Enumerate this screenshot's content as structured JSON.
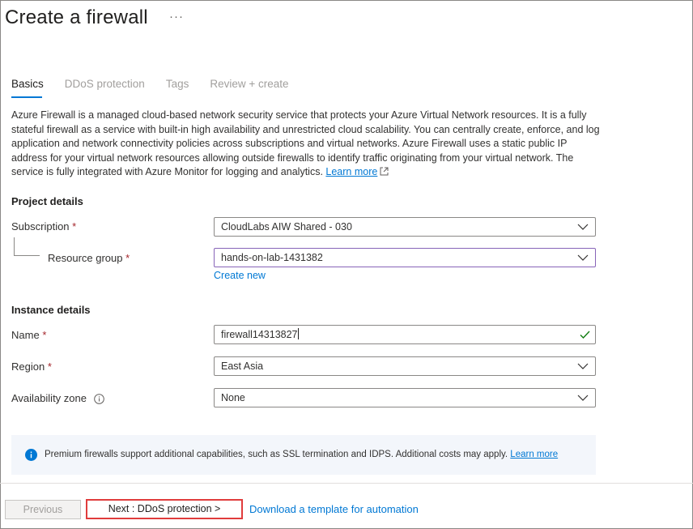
{
  "page": {
    "title": "Create a firewall",
    "more": "···"
  },
  "tabs": [
    {
      "label": "Basics",
      "active": true
    },
    {
      "label": "DDoS protection",
      "active": false
    },
    {
      "label": "Tags",
      "active": false
    },
    {
      "label": "Review + create",
      "active": false
    }
  ],
  "description": {
    "text": "Azure Firewall is a managed cloud-based network security service that protects your Azure Virtual Network resources. It is a fully stateful firewall as a service with built-in high availability and unrestricted cloud scalability. You can centrally create, enforce, and log application and network connectivity policies across subscriptions and virtual networks. Azure Firewall uses a static public IP address for your virtual network resources allowing outside firewalls to identify traffic originating from your virtual network. The service is fully integrated with Azure Monitor for logging and analytics.",
    "learn_more": "Learn more"
  },
  "project_details": {
    "heading": "Project details",
    "subscription_label": "Subscription",
    "subscription_value": "CloudLabs AIW Shared - 030",
    "resource_group_label": "Resource group",
    "resource_group_value": "hands-on-lab-1431382",
    "create_new": "Create new"
  },
  "instance_details": {
    "heading": "Instance details",
    "name_label": "Name",
    "name_value": "firewall14313827",
    "region_label": "Region",
    "region_value": "East Asia",
    "az_label": "Availability zone",
    "az_value": "None"
  },
  "required_marker": "*",
  "banner": {
    "text": "Premium firewalls support additional capabilities, such as SSL termination and IDPS. Additional costs may apply.",
    "learn_more": "Learn more"
  },
  "footer": {
    "previous": "Previous",
    "next": "Next : DDoS protection >",
    "download": "Download a template for automation"
  },
  "colors": {
    "accent": "#0078d4",
    "required": "#a4262c",
    "valid": "#107c10",
    "highlight": "#e03c3c"
  }
}
